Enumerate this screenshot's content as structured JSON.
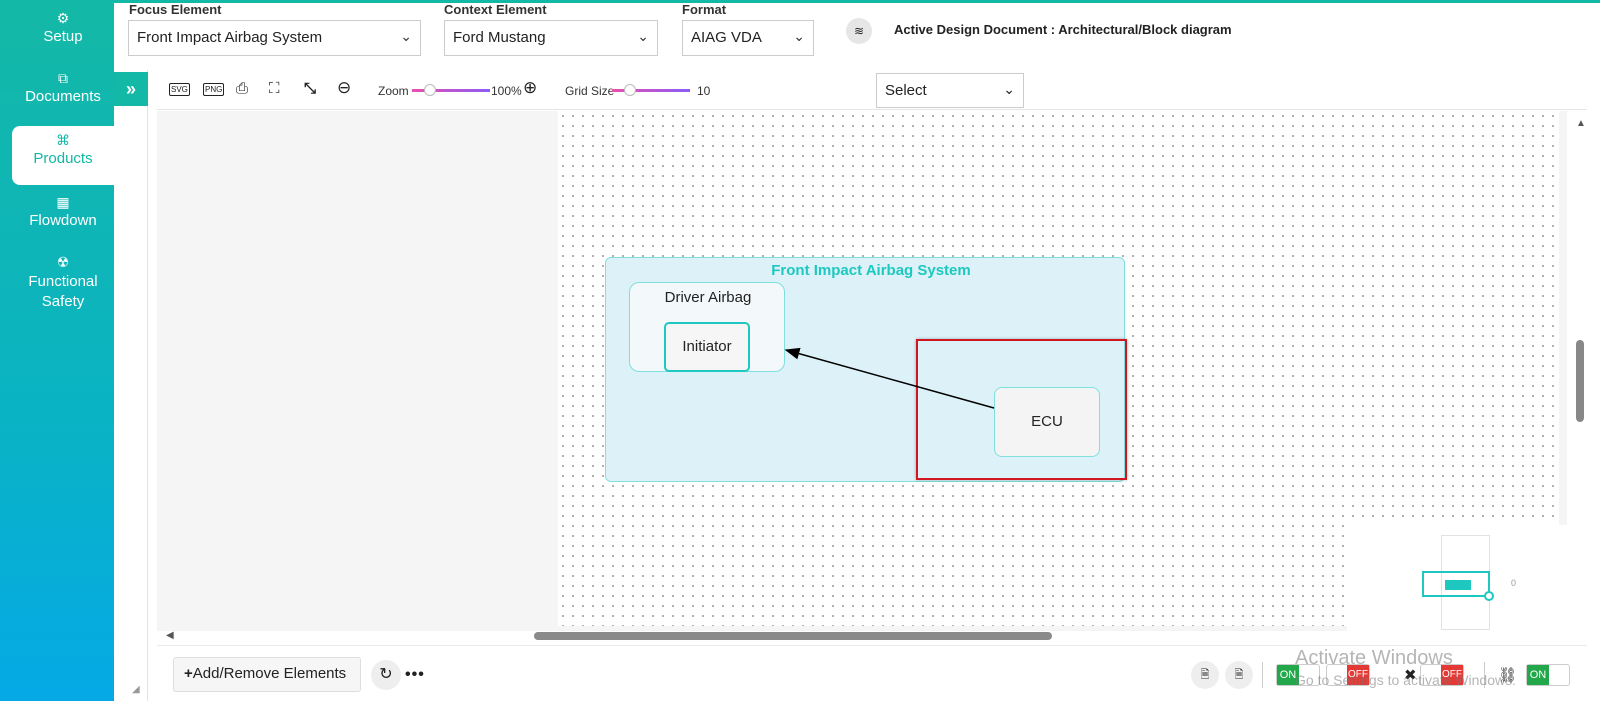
{
  "sidebar": {
    "items": [
      {
        "label": "Setup",
        "icon": "gears-icon"
      },
      {
        "label": "Documents",
        "icon": "copy-icon"
      },
      {
        "label": "Products",
        "icon": "product-icon"
      },
      {
        "label": "Flowdown",
        "icon": "building-icon"
      },
      {
        "label": "Functional Safety",
        "icon": "radiation-icon"
      }
    ],
    "active": "Products",
    "collapse_icon": "»"
  },
  "header": {
    "focus_label": "Focus Element",
    "focus_value": "Front Impact Airbag System",
    "context_label": "Context Element",
    "context_value": "Ford Mustang",
    "format_label": "Format",
    "format_value": "AIAG VDA",
    "active_doc": "Active Design Document : Architectural/Block diagram"
  },
  "toolbar": {
    "svg_label": "SVG",
    "png_label": "PNG",
    "zoom_label": "Zoom",
    "zoom_value": "100%",
    "grid_label": "Grid Size",
    "grid_value": "10",
    "select_value": "Select"
  },
  "diagram": {
    "system_title": "Front Impact Airbag System",
    "subsystem_title": "Driver Airbag",
    "initiator_label": "Initiator",
    "ecu_label": "ECU"
  },
  "minimap": {
    "zero_label": "0"
  },
  "footer": {
    "add_button": "Add/Remove Elements",
    "on_label": "ON",
    "off_label": "OFF"
  },
  "watermark": {
    "line1": "Activate Windows",
    "line2": "Go to Settings to activate Windows."
  },
  "colors": {
    "accent": "#14b8a6",
    "selection": "#d0171f",
    "system_fill": "#dcf2f8"
  }
}
